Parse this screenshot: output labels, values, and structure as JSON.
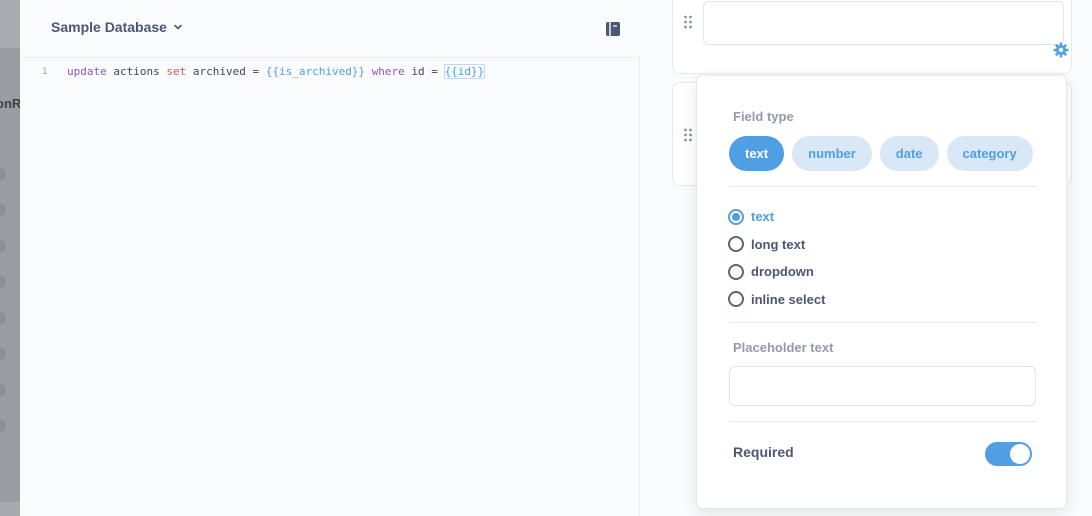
{
  "background_page": {
    "visible_text_fragment": "onR"
  },
  "editor": {
    "database_name": "Sample Database",
    "line_number": "1",
    "sql": {
      "kw_update": "update",
      "t_actions": " actions ",
      "kw_set": "set",
      "t_archived": " archived = ",
      "var_is_archived": "{{is_archived}}",
      "sp1": " ",
      "kw_where": "where",
      "t_id": " id = ",
      "var_id": "{{id}}"
    }
  },
  "field_settings": {
    "field_type_label": "Field type",
    "field_types": [
      "text",
      "number",
      "date",
      "category"
    ],
    "selected_field_type": "text",
    "input_types": [
      "text",
      "long text",
      "dropdown",
      "inline select"
    ],
    "selected_input_type": "text",
    "placeholder_label": "Placeholder text",
    "placeholder_value": "",
    "required_label": "Required",
    "required": true
  },
  "colors": {
    "accent": "#509ee3",
    "accent_light": "#d8e8f6",
    "text_dark": "#4c5773",
    "text_muted": "#949aab"
  }
}
